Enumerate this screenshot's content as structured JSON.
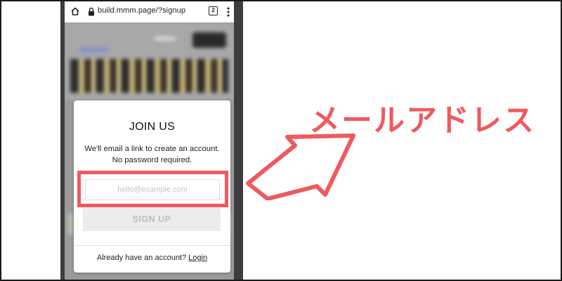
{
  "browser": {
    "url": "build.mmm.page/?signup",
    "tab_count": "2"
  },
  "modal": {
    "title": "JOIN US",
    "description": "We'll email a link to create an account. No password required.",
    "email_placeholder": "hello@example.com",
    "signup_label": "SIGN UP",
    "footer_text": "Already have an account?",
    "login_label": "Login"
  },
  "annotation": {
    "label": "メールアドレス",
    "color": "#f0595f"
  },
  "icons": [
    "home-icon",
    "lock-icon",
    "tabs-icon",
    "more-vert-icon",
    "arrow-icon"
  ]
}
